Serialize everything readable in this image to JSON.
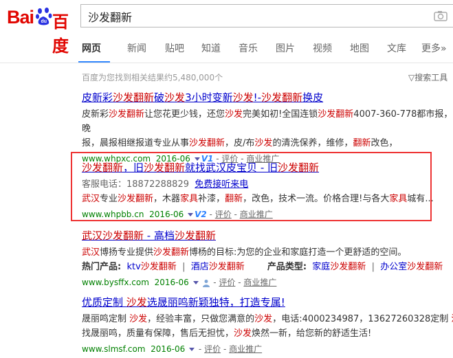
{
  "logo": {
    "bai": "Bai",
    "du": "百度"
  },
  "search": {
    "query": "沙发翻新"
  },
  "tabs": [
    "网页",
    "新闻",
    "贴吧",
    "知道",
    "音乐",
    "图片",
    "视频",
    "地图",
    "文库",
    "更多»"
  ],
  "found_text": "百度为您找到相关结果约5,480,000个",
  "tool_text": "搜索工具",
  "results": [
    {
      "title_parts": [
        "皮新彩",
        "沙发翻新",
        "破",
        "沙发",
        "3小时变新",
        "沙发",
        "!-",
        "沙发翻新",
        "换皮"
      ],
      "abstract_line1_parts": [
        "皮新彩",
        "沙发翻新",
        "让您花更少钱，还您",
        "沙发",
        "完美如初!全国连锁",
        "沙发翻新",
        "4007-360-778都市报，晚"
      ],
      "abstract_line2_parts": [
        "报，晨报相继报道专业从事",
        "沙发翻新",
        "，皮/布",
        "沙发",
        "的清洗保养，维修，",
        "翻新",
        "改色，"
      ],
      "url": "www.whpxc.com",
      "date": "2016-06",
      "v": "V1",
      "eval": "评价",
      "ad": "商业推广"
    },
    {
      "title_parts": [
        "沙发翻新",
        "，旧",
        "沙发翻新",
        "就找武汉皮宝贝 - 旧",
        "沙发翻新"
      ],
      "phone_label": "客服电话：",
      "phone": "18872288829",
      "free_call": "免费接听来电",
      "abstract_parts": [
        "武汉",
        "专业",
        "沙发翻新",
        "，木器",
        "家具",
        "补漆，",
        "翻新",
        "，改色，技术一流。价格合理!与各大",
        "家具",
        "城有..."
      ],
      "url": "www.whpbb.cn",
      "date": "2016-06",
      "v": "V2",
      "eval": "评价",
      "ad": "商业推广"
    },
    {
      "title_parts": [
        "武汉沙发翻新",
        " - 高档",
        "沙发翻新"
      ],
      "abstract_parts": [
        "武汉",
        "博扬专业提供",
        "沙发翻新",
        "博杨的目标:为您的企业和家庭打造一个更舒适的空间。"
      ],
      "hot_label": "热门产品:",
      "hot_items": [
        [
          "ktv",
          "沙发翻新"
        ],
        [
          "酒店",
          "沙发翻新"
        ]
      ],
      "type_label": "产品类型:",
      "type_items": [
        [
          "家庭",
          "沙发翻新"
        ],
        [
          "办公室",
          "沙发翻新"
        ]
      ],
      "url": "www.bysffx.com",
      "date": "2016-06",
      "eval": "评价",
      "ad": "商业推广"
    },
    {
      "title_parts": [
        "优质定制 ",
        "沙发",
        "选晟丽鸣新颖独特，打造专属!"
      ],
      "abstract_line1_parts": [
        "晟丽鸣定制 ",
        "沙发",
        "，经验丰富，只做您满意的",
        "沙发",
        "，电话:4000234987，13627260328定制 ",
        "沙发"
      ],
      "abstract_line2_parts": [
        "找晟丽鸣，质量有保障，售后无担忧，",
        "沙发",
        "焕然一新，给您新的舒适生活!"
      ],
      "url": "www.slmsf.com",
      "date": "2016-06",
      "eval": "评价",
      "ad": "商业推广"
    }
  ]
}
